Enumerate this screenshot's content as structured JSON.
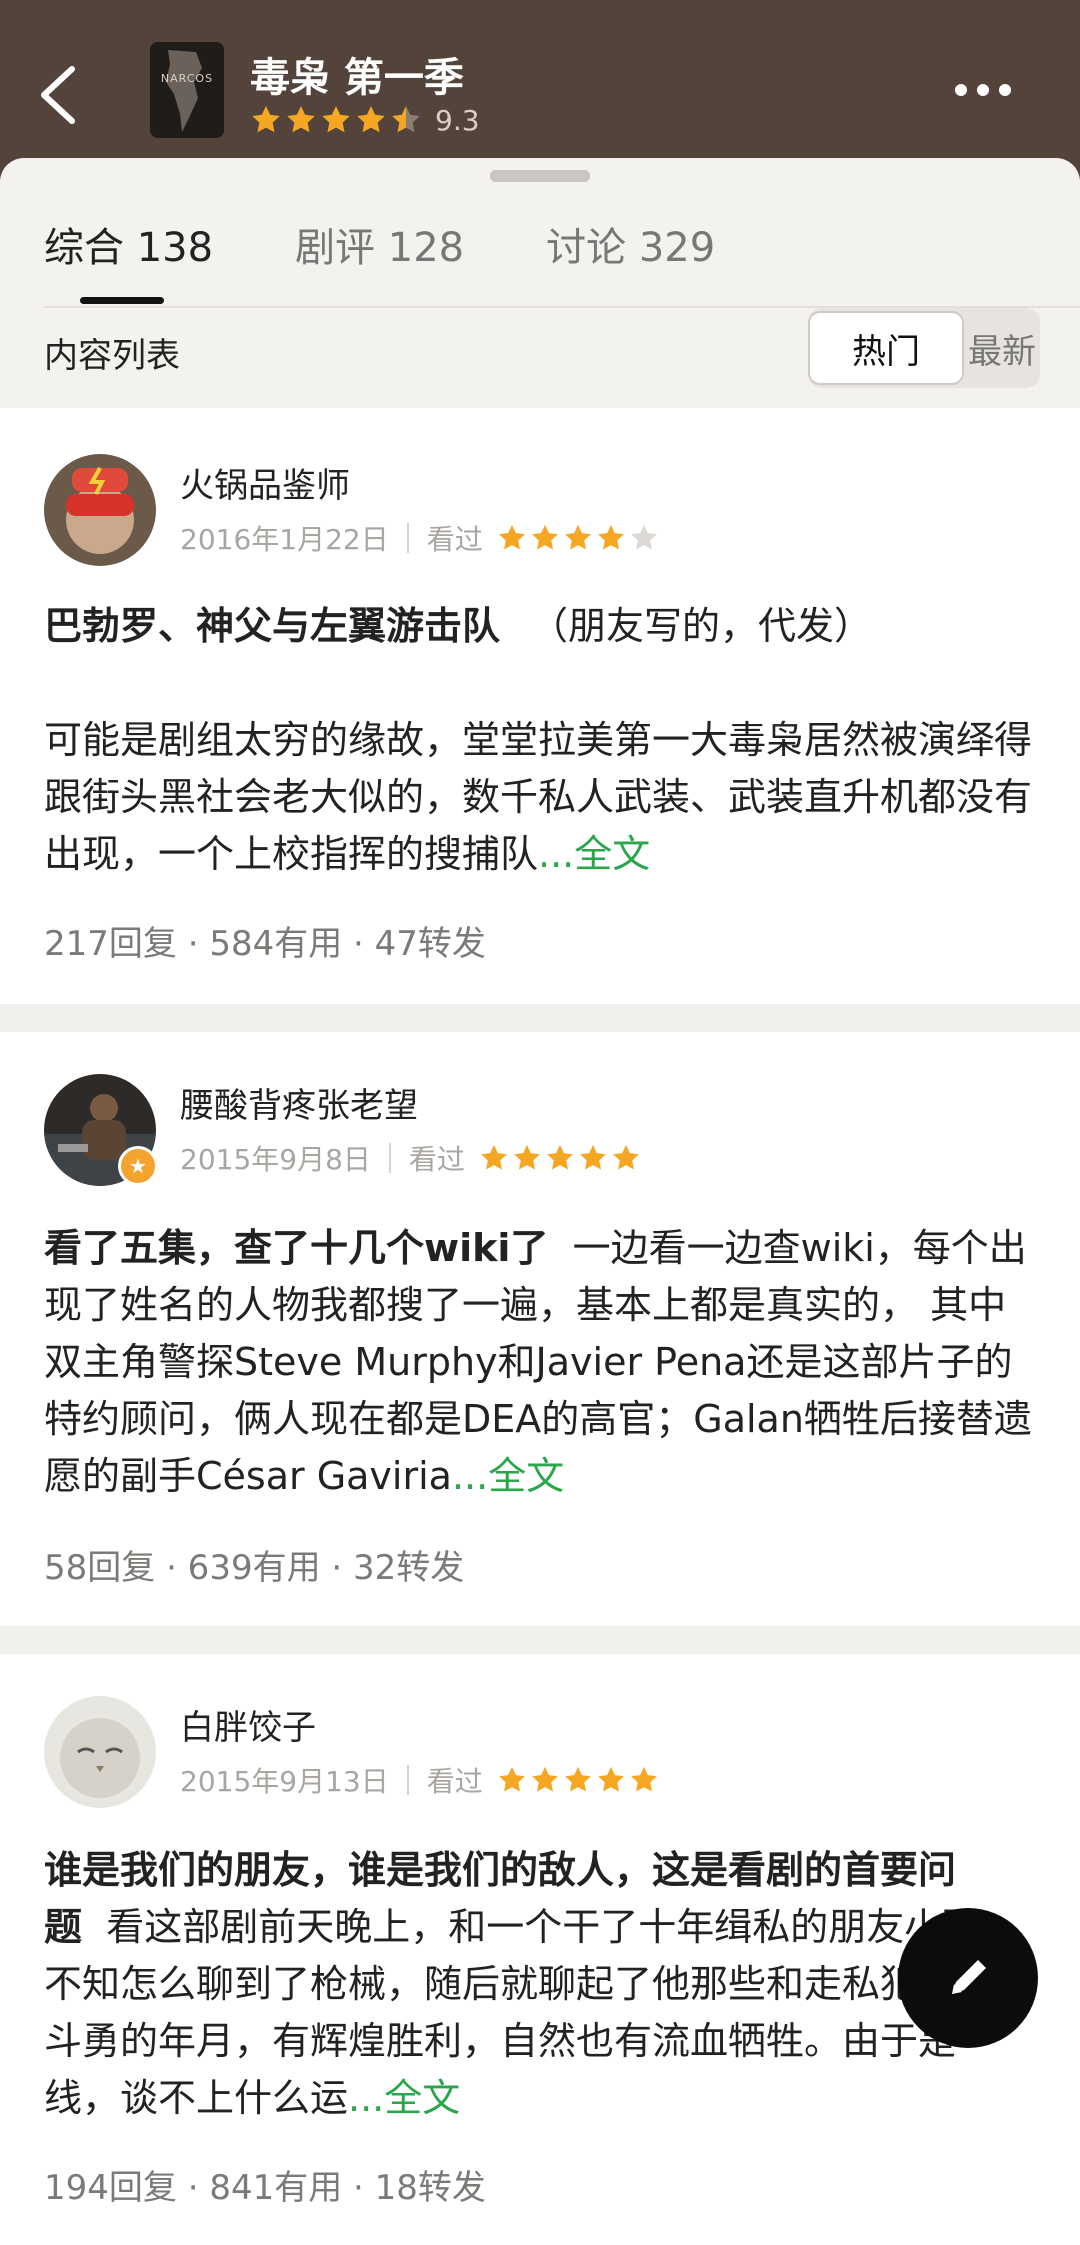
{
  "header": {
    "title": "毒枭 第一季",
    "rating": "9.3",
    "poster_text": "NARCOS",
    "rating_stars": 4.5
  },
  "tabs": [
    {
      "label": "综合 138",
      "active": true
    },
    {
      "label": "剧评 128",
      "active": false
    },
    {
      "label": "讨论 329",
      "active": false
    }
  ],
  "list_label": "内容列表",
  "sort": {
    "hot": "热门",
    "new": "最新"
  },
  "reviews": [
    {
      "name": "火锅品鉴师",
      "date": "2016年1月22日",
      "status": "看过",
      "stars": 4,
      "title": "巴勃罗、神父与左翼游击队",
      "title_note": "（朋友写的，代发）",
      "text": "可能是剧组太穷的缘故，堂堂拉美第一大毒枭居然被演绎得跟街头黑社会老大似的，数千私人武装、武装直升机都没有出现，一个上校指挥的搜捕队",
      "more": "...全文",
      "stats": "217回复 · 584有用 · 47转发"
    },
    {
      "name": "腰酸背疼张老望",
      "date": "2015年9月8日",
      "status": "看过",
      "stars": 5,
      "title": "看了五集，查了十几个wiki了",
      "text": "一边看一边查wiki，每个出现了姓名的人物我都搜了一遍，基本上都是真实的， 其中双主角警探Steve Murphy和Javier Pena还是这部片子的特约顾问，俩人现在都是DEA的高官；Galan牺牲后接替遗愿的副手César Gaviria",
      "more": "...全文",
      "stats": "58回复 · 639有用 · 32转发"
    },
    {
      "name": "白胖饺子",
      "date": "2015年9月13日",
      "status": "看过",
      "stars": 5,
      "title": "谁是我们的朋友，谁是我们的敌人，这是看剧的首要问题",
      "text": "看这部剧前天晚上，和一个干了十年缉私的朋友小酌，不知怎么聊到了枪械，随后就聊起了他那些和走私犯们斗智斗勇的年月，有辉煌胜利，自然也有流血牺牲。由于是一线，谈不上什么运",
      "more": "...全文",
      "stats": "194回复 · 841有用 · 18转发"
    }
  ],
  "colors": {
    "header_bg": "#54433a",
    "star": "#f5a623",
    "link": "#2aa64b"
  }
}
